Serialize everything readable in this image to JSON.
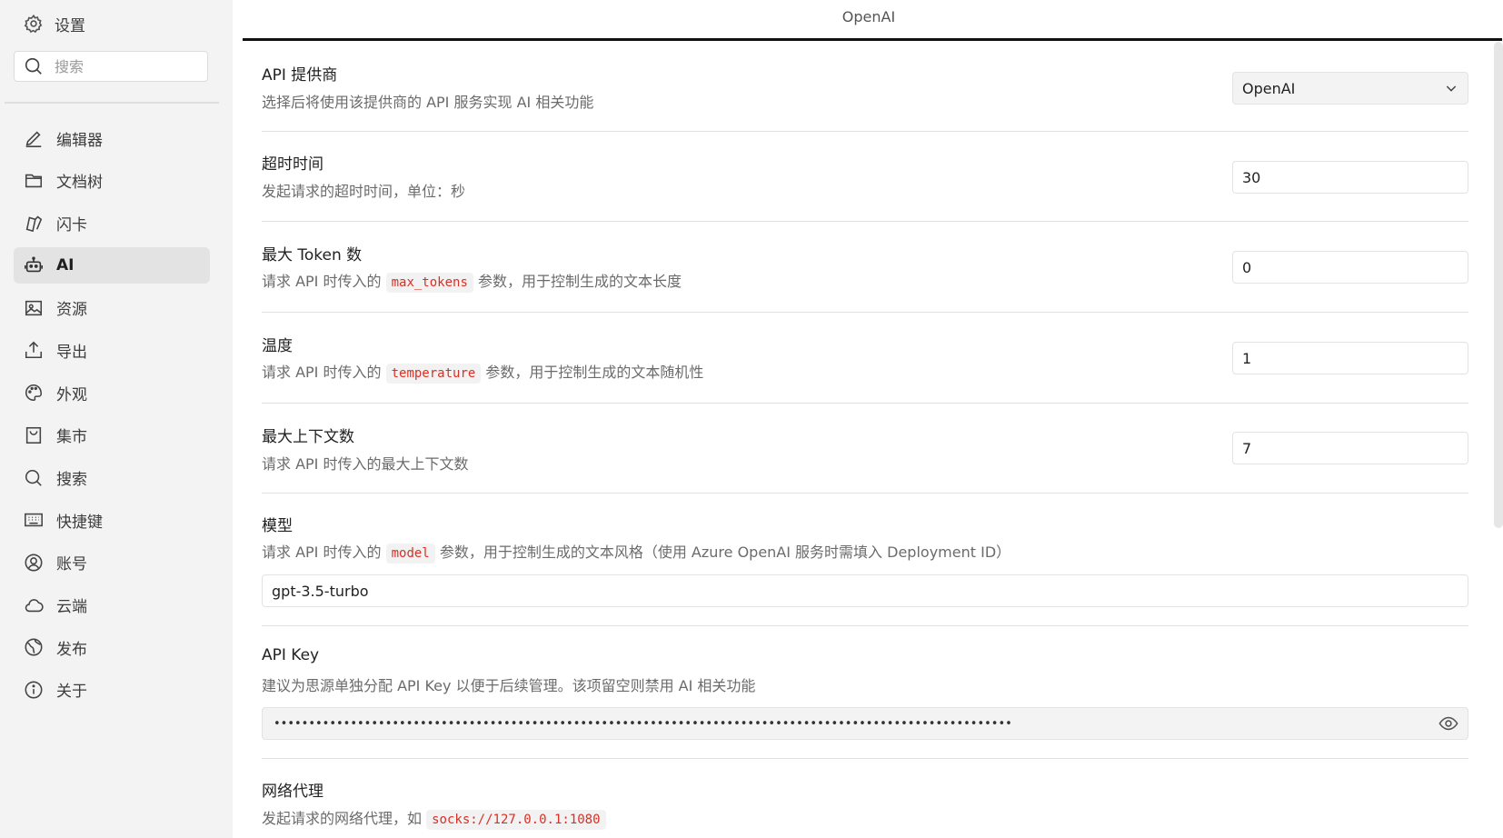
{
  "sidebar": {
    "title": "设置",
    "search_placeholder": "搜索",
    "items": [
      {
        "label": "编辑器",
        "icon": "pen-icon"
      },
      {
        "label": "文档树",
        "icon": "folder-icon"
      },
      {
        "label": "闪卡",
        "icon": "flashcard-icon"
      },
      {
        "label": "AI",
        "icon": "robot-icon",
        "active": true
      },
      {
        "label": "资源",
        "icon": "image-icon"
      },
      {
        "label": "导出",
        "icon": "upload-icon"
      },
      {
        "label": "外观",
        "icon": "palette-icon"
      },
      {
        "label": "集市",
        "icon": "bag-icon"
      },
      {
        "label": "搜索",
        "icon": "search-icon"
      },
      {
        "label": "快捷键",
        "icon": "keyboard-icon"
      },
      {
        "label": "账号",
        "icon": "user-icon"
      },
      {
        "label": "云端",
        "icon": "cloud-icon"
      },
      {
        "label": "发布",
        "icon": "globe-icon"
      },
      {
        "label": "关于",
        "icon": "info-icon"
      }
    ]
  },
  "main": {
    "title": "OpenAI",
    "provider": {
      "label": "API 提供商",
      "desc": "选择后将使用该提供商的 API 服务实现 AI 相关功能",
      "value": "OpenAI"
    },
    "timeout": {
      "label": "超时时间",
      "desc": "发起请求的超时时间，单位：秒",
      "value": "30"
    },
    "max_tokens": {
      "label": "最大 Token 数",
      "desc_pre": "请求 API 时传入的",
      "code": "max_tokens",
      "desc_post": "参数，用于控制生成的文本长度",
      "value": "0"
    },
    "temperature": {
      "label": "温度",
      "desc_pre": "请求 API 时传入的",
      "code": "temperature",
      "desc_post": "参数，用于控制生成的文本随机性",
      "value": "1"
    },
    "max_contexts": {
      "label": "最大上下文数",
      "desc": "请求 API 时传入的最大上下文数",
      "value": "7"
    },
    "model": {
      "label": "模型",
      "desc_pre": "请求 API 时传入的",
      "code": "model",
      "desc_post": "参数，用于控制生成的文本风格（使用 Azure OpenAI 服务时需填入 Deployment ID）",
      "value": "gpt-3.5-turbo"
    },
    "api_key": {
      "label": "API Key",
      "desc": "建议为思源单独分配 API Key 以便于后续管理。该项留空则禁用 AI 相关功能",
      "value": "••••••••••••••••••••••••••••••••••••••••••••••••••••••••••••••••••••••••••••••••••••••••••••••••••••••••••"
    },
    "proxy": {
      "label": "网络代理",
      "desc_pre": "发起请求的网络代理，如",
      "code": "socks://127.0.0.1:1080"
    }
  }
}
